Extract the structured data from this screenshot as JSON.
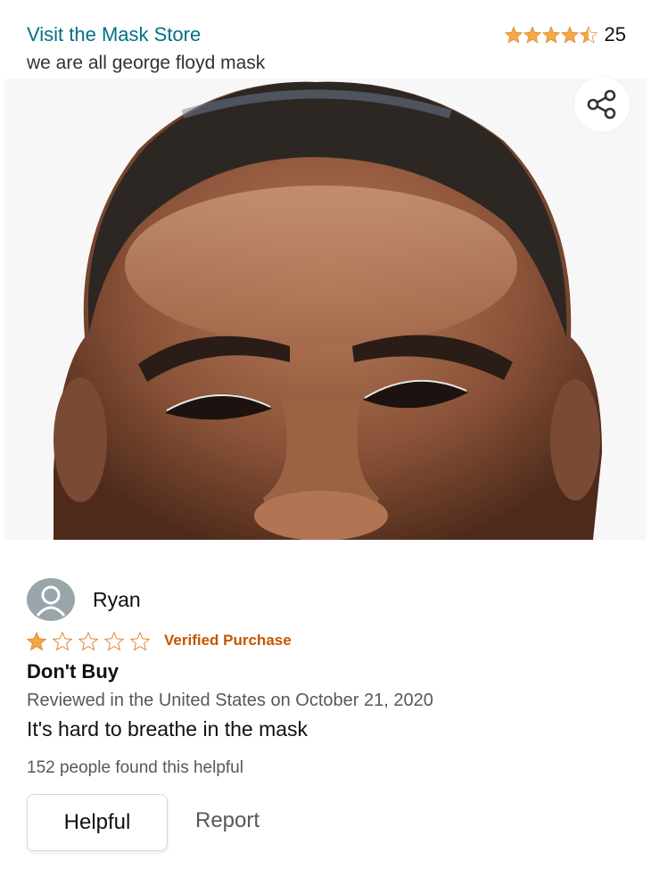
{
  "header": {
    "store_link": "Visit the Mask Store",
    "product_title": "we are all george floyd mask",
    "rating_value": 4.5,
    "rating_count": "25",
    "star_color": "#f3a847"
  },
  "product_image": {
    "description_icon": "face-mask-photo"
  },
  "share": {
    "icon": "share-icon"
  },
  "review": {
    "reviewer_name": "Ryan",
    "rating": 1,
    "verified_label": "Verified Purchase",
    "title": "Don't Buy",
    "date_line": "Reviewed in the United States on October 21, 2020",
    "body": "It's hard to breathe in the mask",
    "helpful_count": "152 people found this helpful",
    "helpful_button": "Helpful",
    "report_link": "Report"
  },
  "colors": {
    "link": "#007185",
    "verified": "#c45500",
    "star": "#f3a847"
  }
}
